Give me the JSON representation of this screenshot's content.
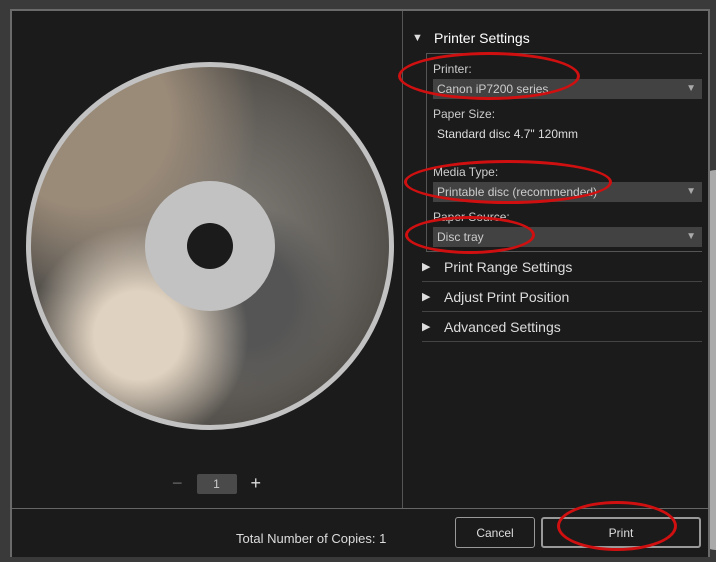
{
  "preview": {
    "copies": "1",
    "minus": "−",
    "plus": "+"
  },
  "printer_settings": {
    "title": "Printer Settings",
    "printer_label": "Printer:",
    "printer_value": "Canon iP7200 series",
    "paper_size_label": "Paper Size:",
    "paper_size_value": "Standard disc 4.7\" 120mm",
    "media_type_label": "Media Type:",
    "media_type_value": "Printable disc (recommended)",
    "paper_source_label": "Paper Source:",
    "paper_source_value": "Disc tray"
  },
  "sections": [
    "Print Range Settings",
    "Adjust Print Position",
    "Advanced Settings"
  ],
  "footer": {
    "total_copies": "Total Number of Copies: 1",
    "cancel": "Cancel",
    "print": "Print"
  },
  "colors": {
    "annotation": "#d01010",
    "background": "#1b1b1b"
  }
}
